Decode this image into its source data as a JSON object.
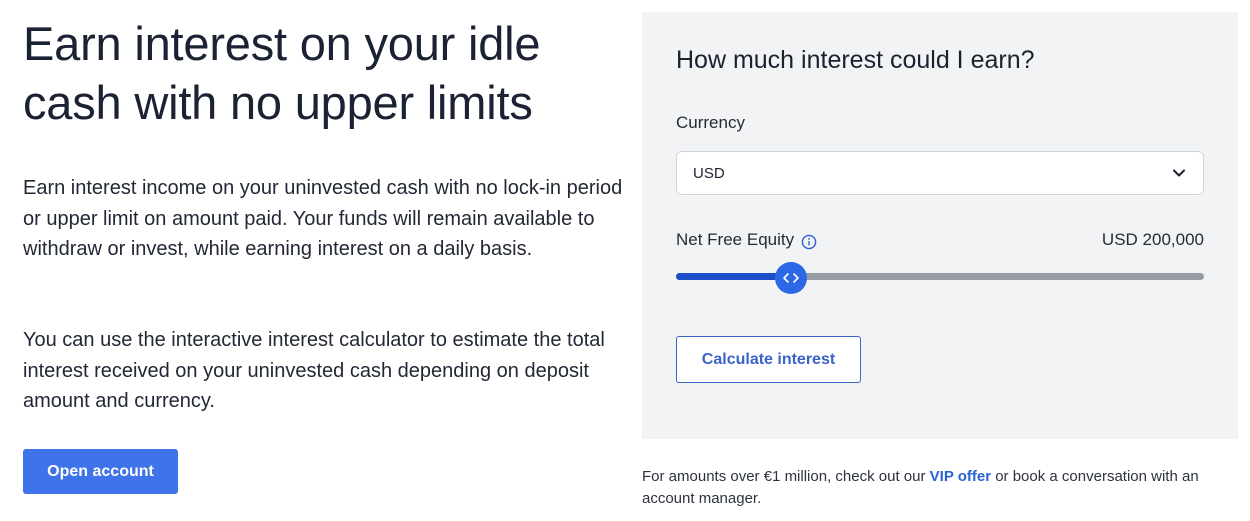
{
  "hero": {
    "headline_line1": "Earn interest on your idle",
    "headline_line2": "cash with no upper limits",
    "paragraph1": "Earn interest income on your uninvested cash with no lock-in period or upper limit on amount paid. Your funds will remain available to withdraw or invest, while earning interest on a daily basis.",
    "paragraph2": "You can use the interactive interest calculator to estimate the total interest received on your uninvested cash depending on deposit amount and currency.",
    "open_account_label": "Open account"
  },
  "calculator": {
    "title": "How much interest could I earn?",
    "currency_label": "Currency",
    "currency_value": "USD",
    "net_free_equity_label": "Net Free Equity",
    "net_free_equity_value": "USD 200,000",
    "slider_fraction": 0.218,
    "calculate_label": "Calculate interest"
  },
  "footer": {
    "text_before": "For amounts over €1 million, check out our ",
    "link_label": "VIP offer",
    "text_after": " or book a conversation with an account manager."
  },
  "colors": {
    "accent": "#3e73ea",
    "slider_fill": "#1d4ec7",
    "slider_track": "#979ba3",
    "panel_bg": "#f2f3f5",
    "link": "#2a62d8"
  },
  "icons": [
    "chevron-down-icon",
    "info-icon",
    "slider-arrows-icon"
  ]
}
